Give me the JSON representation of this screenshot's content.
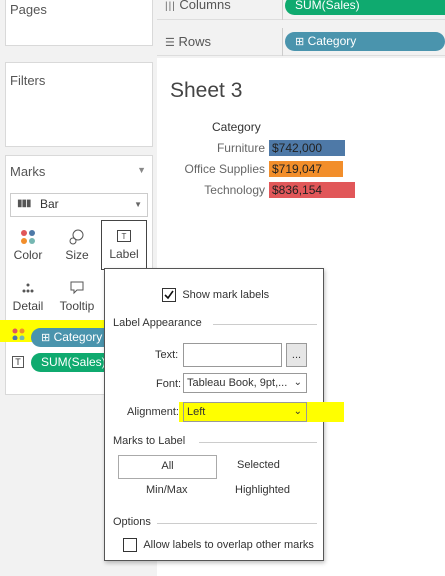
{
  "left_panel": {
    "pages_title": "Pages",
    "filters_title": "Filters",
    "marks_title": "Marks",
    "mark_type": "Bar",
    "buttons": {
      "color": "Color",
      "size": "Size",
      "label": "Label",
      "detail": "Detail",
      "tooltip": "Tooltip"
    },
    "mark_fields": [
      {
        "icon": "color-dots-icon",
        "pill": "Category"
      },
      {
        "icon": "text-T-icon",
        "pill": "SUM(Sales)"
      }
    ]
  },
  "shelves": {
    "columns_label": "Columns",
    "columns_pill": "SUM(Sales)",
    "rows_label": "Rows",
    "rows_pill": "Category"
  },
  "sheet": {
    "title": "Sheet 3",
    "header": "Category"
  },
  "chart_data": {
    "type": "bar",
    "orientation": "horizontal",
    "categories": [
      "Furniture",
      "Office Supplies",
      "Technology"
    ],
    "values": [
      742000,
      719047,
      836154
    ],
    "labels": [
      "$742,000",
      "$719,047",
      "$836,154"
    ],
    "colors": [
      "#4e79a7",
      "#f28e2b",
      "#e15759"
    ],
    "row_header": "Category"
  },
  "popup": {
    "show_mark_labels": "Show mark labels",
    "label_appearance": "Label Appearance",
    "text_label": "Text:",
    "text_value": "",
    "ellipsis": "...",
    "font_label": "Font:",
    "font_value": "Tableau Book, 9pt,...",
    "alignment_label": "Alignment:",
    "alignment_value": "Left",
    "marks_to_label": "Marks to Label",
    "options": {
      "all": "All",
      "selected": "Selected",
      "min_max": "Min/Max",
      "highlighted": "Highlighted"
    },
    "options_title": "Options",
    "overlap_label": "Allow labels to overlap other marks"
  },
  "colors": {
    "highlight": "#ffff00",
    "green_pill": "#0faa6f",
    "blue_pill": "#4a94ad"
  }
}
